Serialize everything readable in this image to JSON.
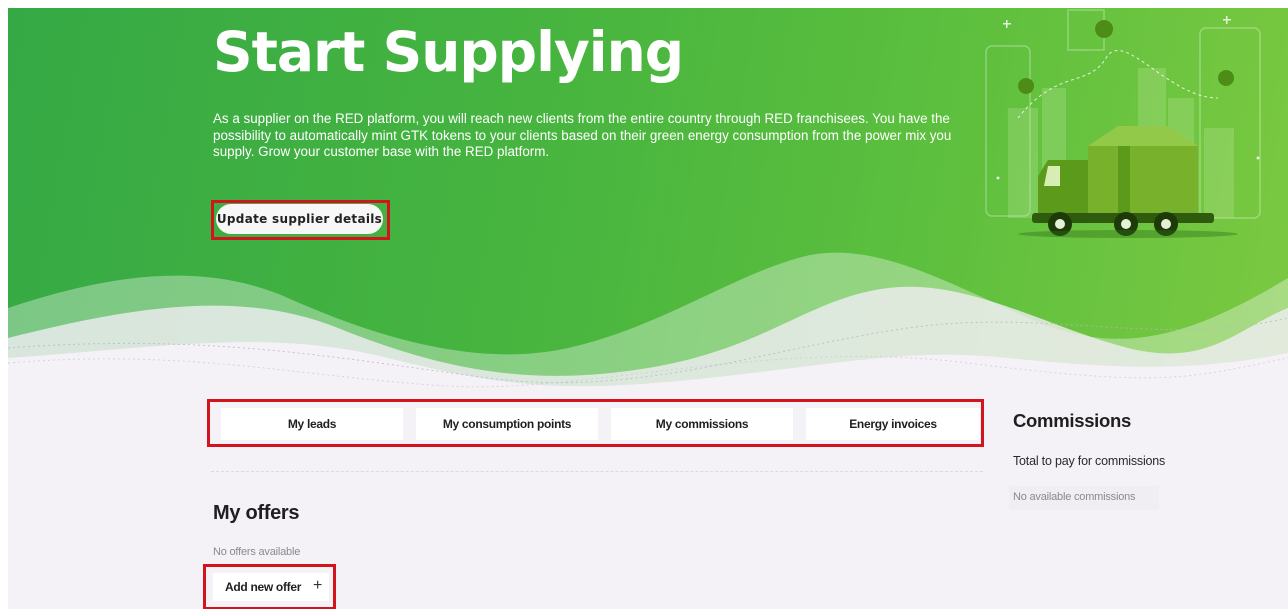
{
  "hero": {
    "title": "Start Supplying",
    "description": "As a supplier on the RED platform, you will reach new clients from the entire country through RED franchisees. You have the possibility to automatically mint GTK tokens to your clients based on their green energy consumption from the power mix you supply. Grow your customer base with the RED platform.",
    "update_button": "Update supplier details"
  },
  "tabs": [
    {
      "label": "My leads"
    },
    {
      "label": "My consumption points"
    },
    {
      "label": "My commissions"
    },
    {
      "label": "Energy invoices"
    }
  ],
  "offers": {
    "title": "My offers",
    "empty_text": "No offers available",
    "add_button": "Add new offer",
    "add_icon": "plus-icon",
    "add_symbol": "+"
  },
  "commissions": {
    "title": "Commissions",
    "subtitle": "Total to pay for commissions",
    "empty_text": "No available commissions"
  },
  "colors": {
    "hero_start": "#35a945",
    "hero_end": "#7cc941",
    "highlight": "#d3141e",
    "truck": "#4d8d17"
  }
}
